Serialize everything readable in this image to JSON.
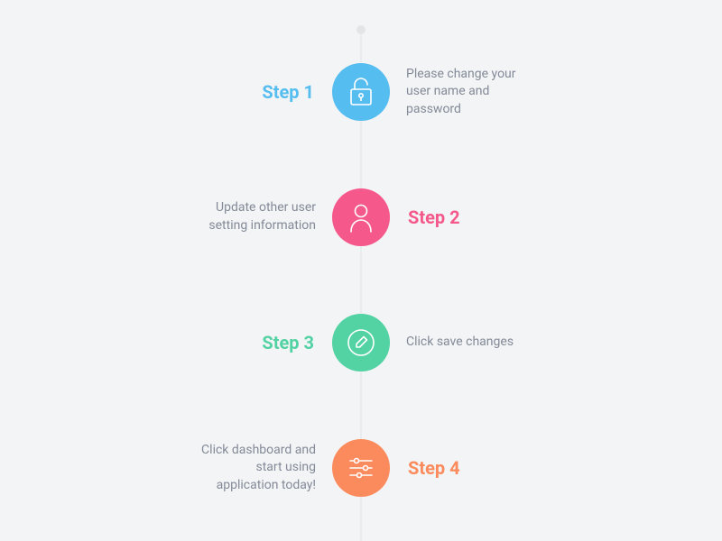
{
  "steps": [
    {
      "label": "Step 1",
      "description": "Please change your user name and password",
      "icon": "lock-open-icon",
      "color": "blue",
      "labelSide": "left",
      "descSide": "right"
    },
    {
      "label": "Step 2",
      "description": "Update other user setting information",
      "icon": "user-icon",
      "color": "pink",
      "labelSide": "right",
      "descSide": "left"
    },
    {
      "label": "Step 3",
      "description": "Click save changes",
      "icon": "edit-icon",
      "color": "green",
      "labelSide": "left",
      "descSide": "right"
    },
    {
      "label": "Step 4",
      "description": "Click dashboard and start using application today!",
      "icon": "sliders-icon",
      "color": "orange",
      "labelSide": "right",
      "descSide": "left"
    }
  ],
  "colors": {
    "blue": "#55bdf0",
    "pink": "#f5598b",
    "green": "#53d2a3",
    "orange": "#fb8b5c",
    "text": "#838a97",
    "bg": "#f3f4f6"
  }
}
